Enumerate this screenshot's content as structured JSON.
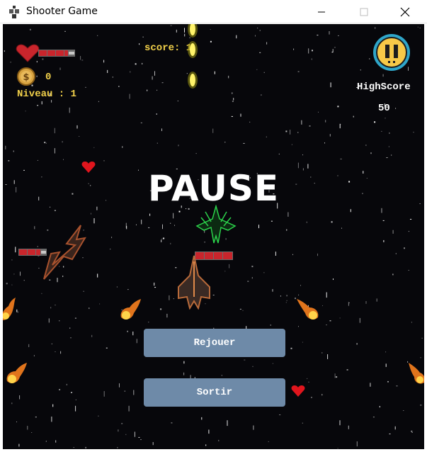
{
  "window": {
    "title": "Shooter Game",
    "controls": [
      "minimize",
      "maximize",
      "close"
    ]
  },
  "hud": {
    "score_label": "score: 1",
    "coins": "0",
    "level_label": "Niveau : 1",
    "highscore_label": "HighScore",
    "highscore_value": "50",
    "player_health_fraction": 0.8
  },
  "pause_menu": {
    "title": "PAUSE",
    "replay_label": "Rejouer",
    "quit_label": "Sortir"
  },
  "colors": {
    "background": "#07070b",
    "hud_yellow": "#f2d14a",
    "button": "#6e8aa8",
    "health_red": "#c9252c",
    "pause_button_ring": "#2fa6c9",
    "pause_button_fill": "#f7c948"
  },
  "icons": [
    "window-app-icon",
    "heart-icon",
    "coin-icon",
    "pause-button-icon",
    "heart-pickup-icon",
    "enemy-ship-icon",
    "player-ship-icon",
    "fireball-icon",
    "laser-bullet-icon"
  ]
}
